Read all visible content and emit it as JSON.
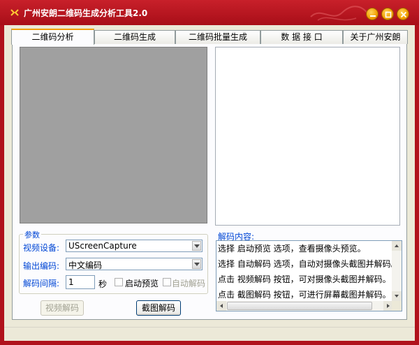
{
  "window": {
    "title": "广州安朗二维码生成分析工具2.0",
    "title_color": "#ffffff",
    "frame_color": "#b0121c"
  },
  "tabs": [
    {
      "label": "二维码分析",
      "active": true
    },
    {
      "label": "二维码生成",
      "active": false
    },
    {
      "label": "二维码批量生成",
      "active": false
    },
    {
      "label": "数 据 接 口",
      "active": false
    },
    {
      "label": "关于广州安朗",
      "active": false
    }
  ],
  "params": {
    "group_title": "参数",
    "video_device_label": "视频设备:",
    "video_device_value": "UScreenCapture",
    "output_encoding_label": "输出编码:",
    "output_encoding_value": "中文编码",
    "interval_label": "解码间隔:",
    "interval_value": "1",
    "interval_unit": "秒",
    "preview_checkbox_label": "启动预览",
    "preview_checked": false,
    "auto_decode_checkbox_label": "自动解码",
    "auto_decode_checked": false
  },
  "buttons": {
    "video_decode": "视频解码",
    "screenshot_decode": "截图解码"
  },
  "result": {
    "label": "解码内容:",
    "lines": [
      "选择 启动预览 选项，查看摄像头预览。",
      "选择 自动解码 选项，自动对摄像头截图并解码。",
      "点击 视频解码 按钮，可对摄像头截图并解码。",
      "点击 截图解码 按钮，可进行屏幕截图并解码。"
    ]
  },
  "colors": {
    "label_blue": "#0046d5",
    "tab_highlight": "#f0a000",
    "preview_gray": "#a0a0a0"
  },
  "icons": {
    "app": "qr-app-icon",
    "minimize": "minimize-icon",
    "maximize": "maximize-icon",
    "close": "close-icon"
  }
}
